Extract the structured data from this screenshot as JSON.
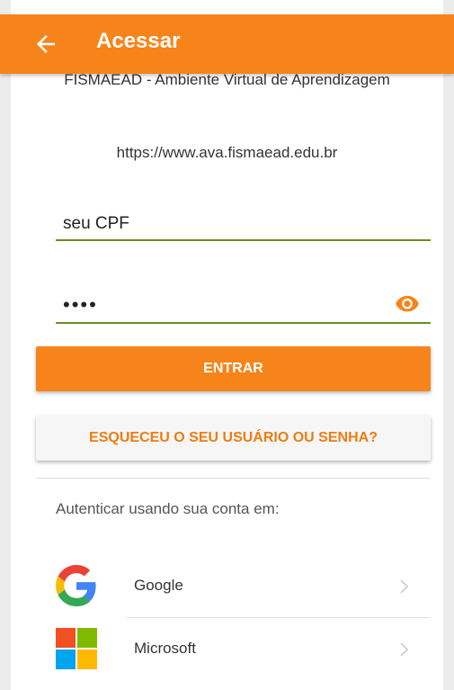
{
  "appbar": {
    "title": "Acessar",
    "back_icon": "arrow-left-icon"
  },
  "site": {
    "name": "FISMAEAD - Ambiente Virtual de Aprendizagem",
    "url": "https://www.ava.fismaead.edu.br"
  },
  "form": {
    "username_value": "seu CPF",
    "password_value": "••••",
    "password_toggle_icon": "eye-icon",
    "login_label": "ENTRAR",
    "forgot_label": "ESQUECEU O SEU USUÁRIO OU SENHA?"
  },
  "auth": {
    "label": "Autenticar usando sua conta em:",
    "providers": [
      {
        "name": "Google",
        "icon": "google-logo-icon"
      },
      {
        "name": "Microsoft",
        "icon": "microsoft-logo-icon"
      }
    ]
  },
  "colors": {
    "accent": "#f7841a",
    "field_underline": "#6b8e23",
    "forgot_text": "#f07c10"
  }
}
